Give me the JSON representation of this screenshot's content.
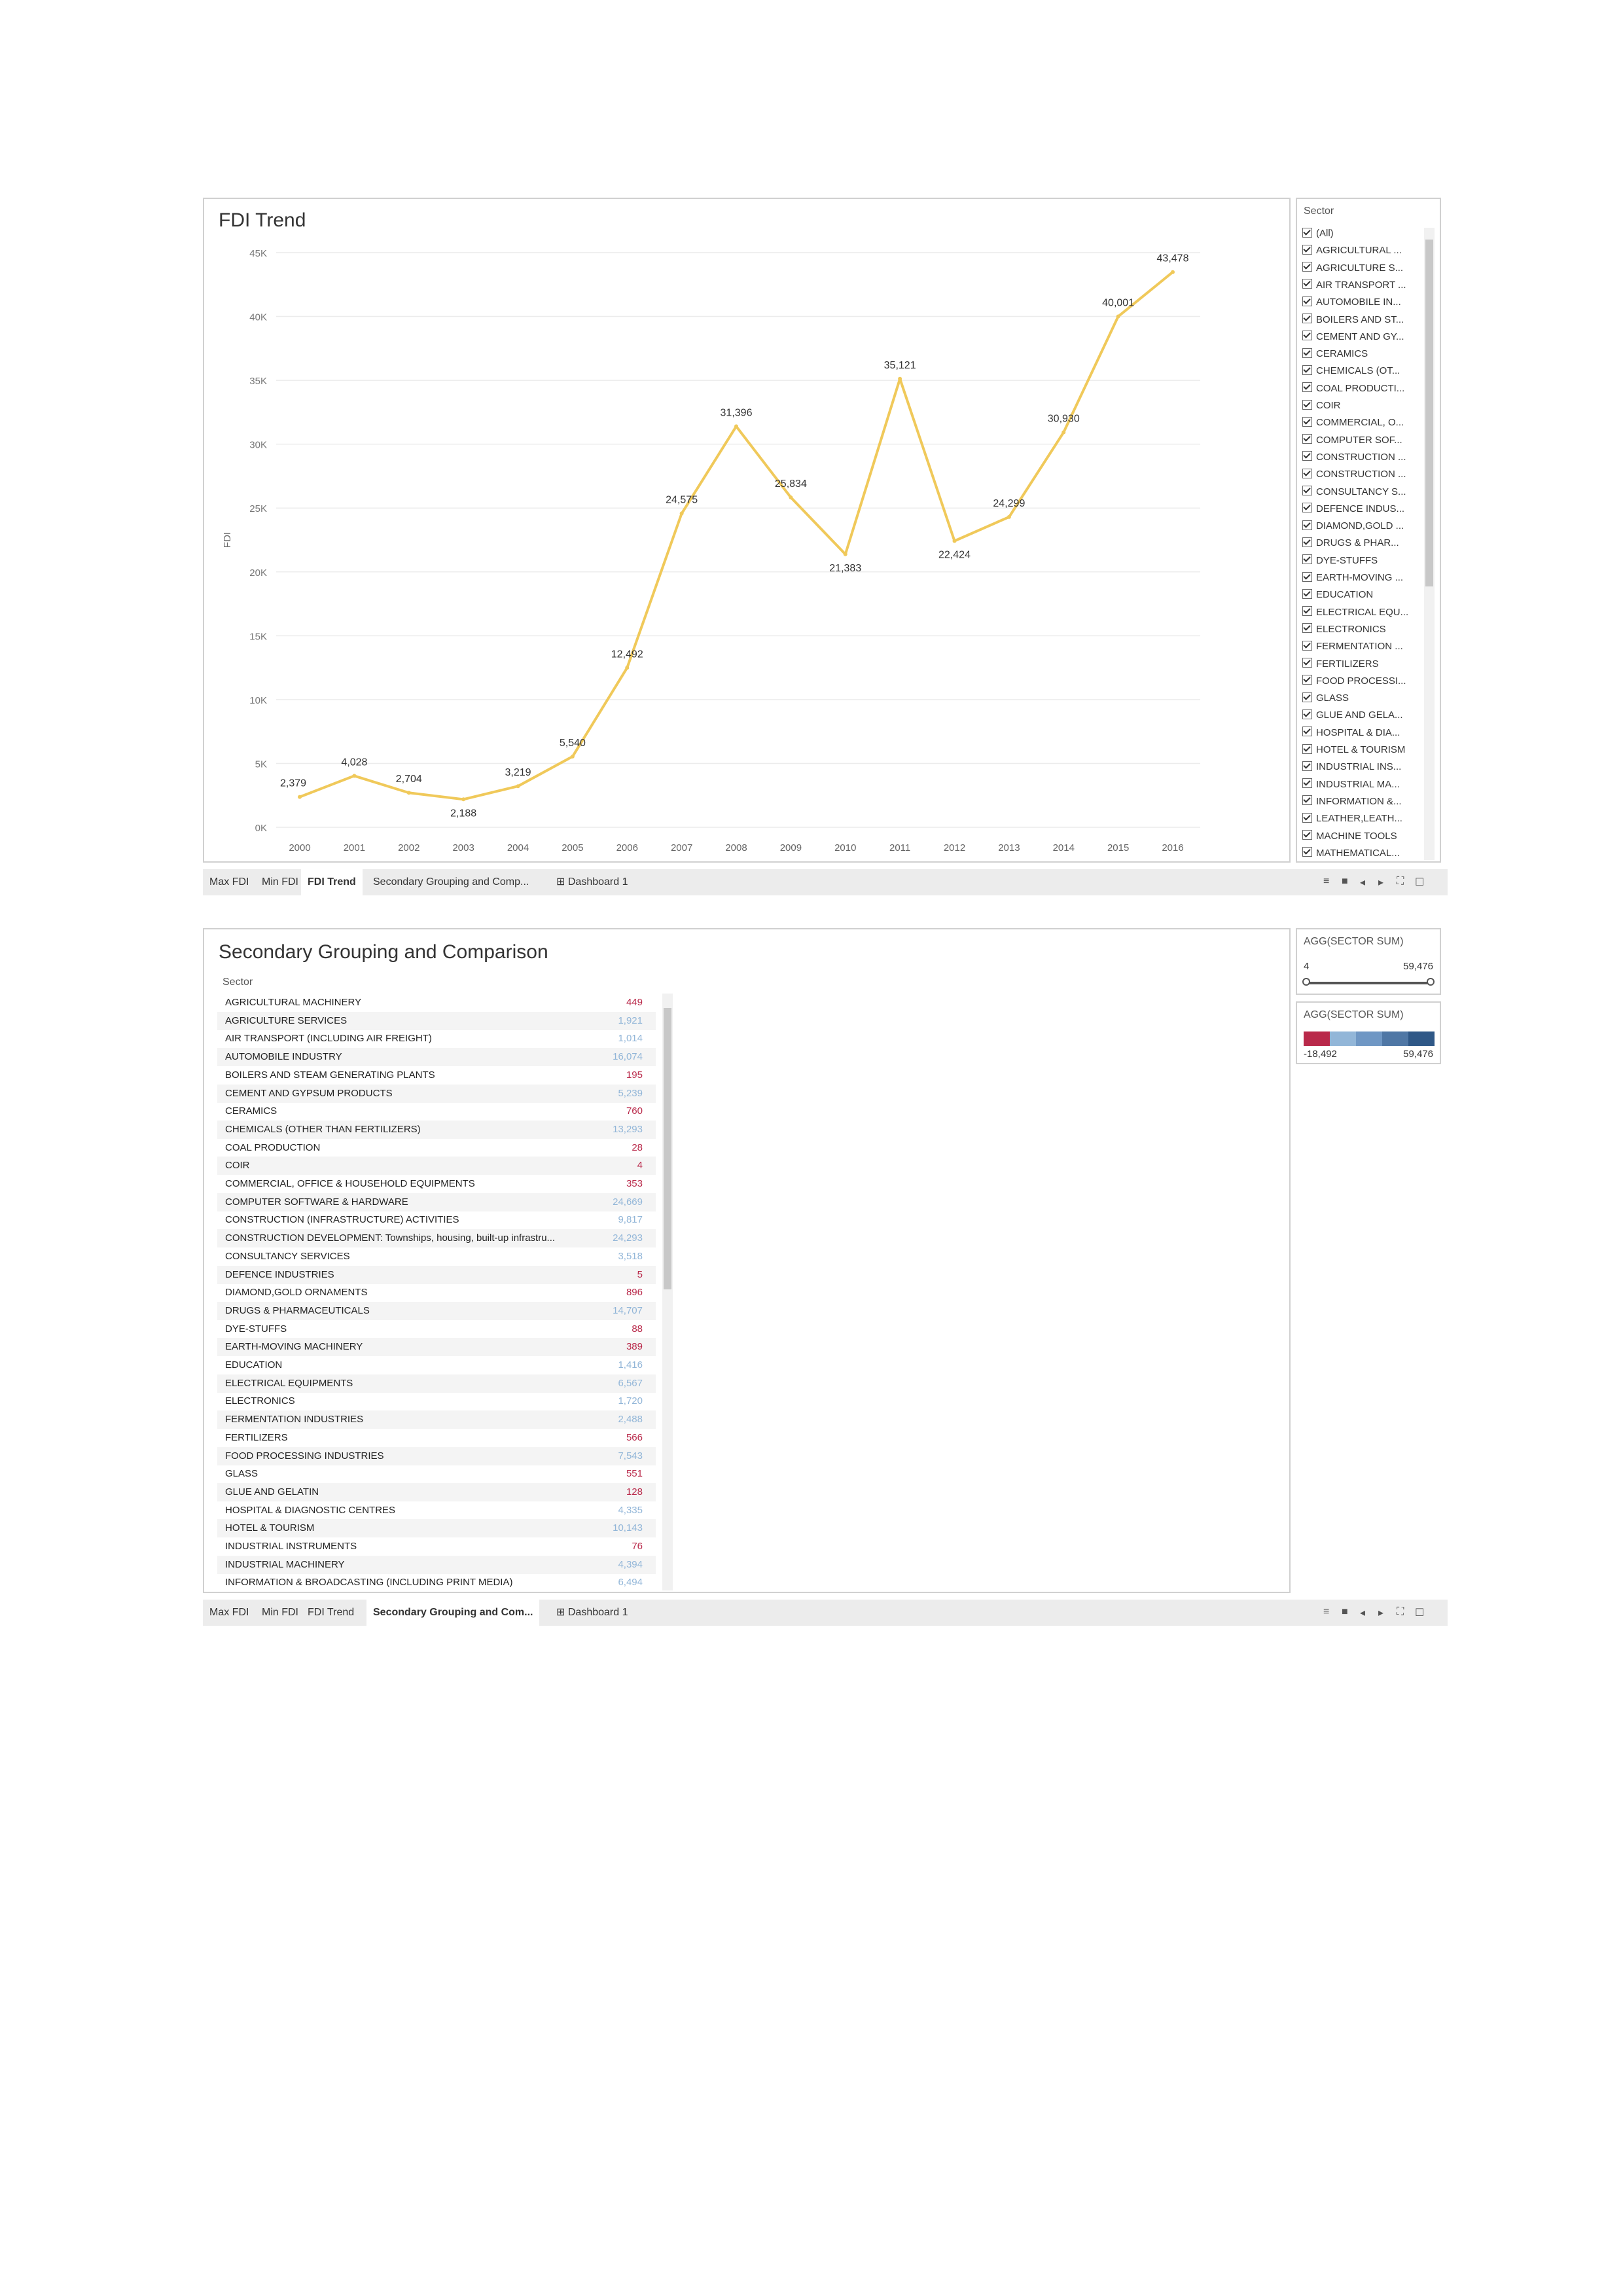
{
  "top_view": {
    "title": "FDI Trend",
    "sector_filter": {
      "title": "Sector",
      "items": [
        "(All)",
        "AGRICULTURAL ...",
        "AGRICULTURE S...",
        "AIR TRANSPORT ...",
        "AUTOMOBILE IN...",
        "BOILERS AND ST...",
        "CEMENT AND GY...",
        "CERAMICS",
        "CHEMICALS (OT...",
        "COAL PRODUCTI...",
        "COIR",
        "COMMERCIAL, O...",
        "COMPUTER SOF...",
        "CONSTRUCTION ...",
        "CONSTRUCTION ...",
        "CONSULTANCY S...",
        "DEFENCE INDUS...",
        "DIAMOND,GOLD ...",
        "DRUGS & PHAR...",
        "DYE-STUFFS",
        "EARTH-MOVING ...",
        "EDUCATION",
        "ELECTRICAL EQU...",
        "ELECTRONICS",
        "FERMENTATION ...",
        "FERTILIZERS",
        "FOOD PROCESSI...",
        "GLASS",
        "GLUE AND GELA...",
        "HOSPITAL & DIA...",
        "HOTEL & TOURISM",
        "INDUSTRIAL INS...",
        "INDUSTRIAL MA...",
        "INFORMATION &...",
        "LEATHER,LEATH...",
        "MACHINE TOOLS",
        "MATHEMATICAL..."
      ]
    },
    "tabs": [
      "Max FDI",
      "Min FDI",
      "FDI Trend",
      "Secondary Grouping and Comp...",
      "Dashboard 1"
    ],
    "active_tab": 2
  },
  "bottom_view": {
    "title": "Secondary Grouping and Comparison",
    "column_header": "Sector",
    "rows": [
      {
        "name": "AGRICULTURAL MACHINERY",
        "value": "449",
        "color": "#b9294a"
      },
      {
        "name": "AGRICULTURE SERVICES",
        "value": "1,921",
        "color": "#92b6d8"
      },
      {
        "name": "AIR TRANSPORT (INCLUDING AIR FREIGHT)",
        "value": "1,014",
        "color": "#92b6d8"
      },
      {
        "name": "AUTOMOBILE INDUSTRY",
        "value": "16,074",
        "color": "#92b6d8"
      },
      {
        "name": "BOILERS AND STEAM GENERATING PLANTS",
        "value": "195",
        "color": "#b9294a"
      },
      {
        "name": "CEMENT AND GYPSUM PRODUCTS",
        "value": "5,239",
        "color": "#92b6d8"
      },
      {
        "name": "CERAMICS",
        "value": "760",
        "color": "#b9294a"
      },
      {
        "name": "CHEMICALS (OTHER THAN FERTILIZERS)",
        "value": "13,293",
        "color": "#92b6d8"
      },
      {
        "name": "COAL PRODUCTION",
        "value": "28",
        "color": "#b9294a"
      },
      {
        "name": "COIR",
        "value": "4",
        "color": "#b9294a"
      },
      {
        "name": "COMMERCIAL, OFFICE & HOUSEHOLD EQUIPMENTS",
        "value": "353",
        "color": "#b9294a"
      },
      {
        "name": "COMPUTER SOFTWARE & HARDWARE",
        "value": "24,669",
        "color": "#92b6d8"
      },
      {
        "name": "CONSTRUCTION (INFRASTRUCTURE) ACTIVITIES",
        "value": "9,817",
        "color": "#92b6d8"
      },
      {
        "name": "CONSTRUCTION DEVELOPMENT: Townships, housing, built-up infrastru...",
        "value": "24,293",
        "color": "#92b6d8"
      },
      {
        "name": "CONSULTANCY SERVICES",
        "value": "3,518",
        "color": "#92b6d8"
      },
      {
        "name": "DEFENCE INDUSTRIES",
        "value": "5",
        "color": "#b9294a"
      },
      {
        "name": "DIAMOND,GOLD ORNAMENTS",
        "value": "896",
        "color": "#b9294a"
      },
      {
        "name": "DRUGS & PHARMACEUTICALS",
        "value": "14,707",
        "color": "#92b6d8"
      },
      {
        "name": "DYE-STUFFS",
        "value": "88",
        "color": "#b9294a"
      },
      {
        "name": "EARTH-MOVING MACHINERY",
        "value": "389",
        "color": "#b9294a"
      },
      {
        "name": "EDUCATION",
        "value": "1,416",
        "color": "#92b6d8"
      },
      {
        "name": "ELECTRICAL EQUIPMENTS",
        "value": "6,567",
        "color": "#92b6d8"
      },
      {
        "name": "ELECTRONICS",
        "value": "1,720",
        "color": "#92b6d8"
      },
      {
        "name": "FERMENTATION INDUSTRIES",
        "value": "2,488",
        "color": "#92b6d8"
      },
      {
        "name": "FERTILIZERS",
        "value": "566",
        "color": "#b9294a"
      },
      {
        "name": "FOOD PROCESSING INDUSTRIES",
        "value": "7,543",
        "color": "#92b6d8"
      },
      {
        "name": "GLASS",
        "value": "551",
        "color": "#b9294a"
      },
      {
        "name": "GLUE AND GELATIN",
        "value": "128",
        "color": "#b9294a"
      },
      {
        "name": "HOSPITAL & DIAGNOSTIC CENTRES",
        "value": "4,335",
        "color": "#92b6d8"
      },
      {
        "name": "HOTEL & TOURISM",
        "value": "10,143",
        "color": "#92b6d8"
      },
      {
        "name": "INDUSTRIAL INSTRUMENTS",
        "value": "76",
        "color": "#b9294a"
      },
      {
        "name": "INDUSTRIAL MACHINERY",
        "value": "4,394",
        "color": "#92b6d8"
      },
      {
        "name": "INFORMATION & BROADCASTING (INCLUDING PRINT MEDIA)",
        "value": "6,494",
        "color": "#92b6d8"
      }
    ],
    "range_filter": {
      "title": "AGG(SECTOR SUM)",
      "min": "4",
      "max": "59,476"
    },
    "color_legend": {
      "title": "AGG(SECTOR SUM)",
      "min": "-18,492",
      "max": "59,476",
      "colors": [
        "#b9294a",
        "#92b6d8",
        "#6f97c4",
        "#4f77a5",
        "#2f5887"
      ]
    },
    "tabs": [
      "Max FDI",
      "Min FDI",
      "FDI Trend",
      "Secondary Grouping and Com...",
      "Dashboard 1"
    ],
    "active_tab": 3
  },
  "chart_data": {
    "type": "line",
    "title": "FDI Trend",
    "xlabel": "",
    "ylabel": "FDI",
    "x": [
      "2000",
      "2001",
      "2002",
      "2003",
      "2004",
      "2005",
      "2006",
      "2007",
      "2008",
      "2009",
      "2010",
      "2011",
      "2012",
      "2013",
      "2014",
      "2015",
      "2016"
    ],
    "series": [
      {
        "values": [
          2379,
          4028,
          2704,
          2188,
          3219,
          5540,
          12492,
          24575,
          31396,
          25834,
          21383,
          35121,
          22424,
          24299,
          30930,
          40001,
          43478
        ]
      }
    ],
    "point_labels": [
      "2,379",
      "4,028",
      "2,704",
      "2,188",
      "3,219",
      "5,540",
      "12,492",
      "24,575",
      "31,396",
      "25,834",
      "21,383",
      "35,121",
      "22,424",
      "24,299",
      "30,930",
      "40,001",
      "43,478"
    ],
    "y_ticks": [
      "0K",
      "5K",
      "10K",
      "15K",
      "20K",
      "25K",
      "30K",
      "35K",
      "40K",
      "45K"
    ],
    "ylim": [
      0,
      45000
    ],
    "line_color": "#f0c95a",
    "grid": true
  }
}
